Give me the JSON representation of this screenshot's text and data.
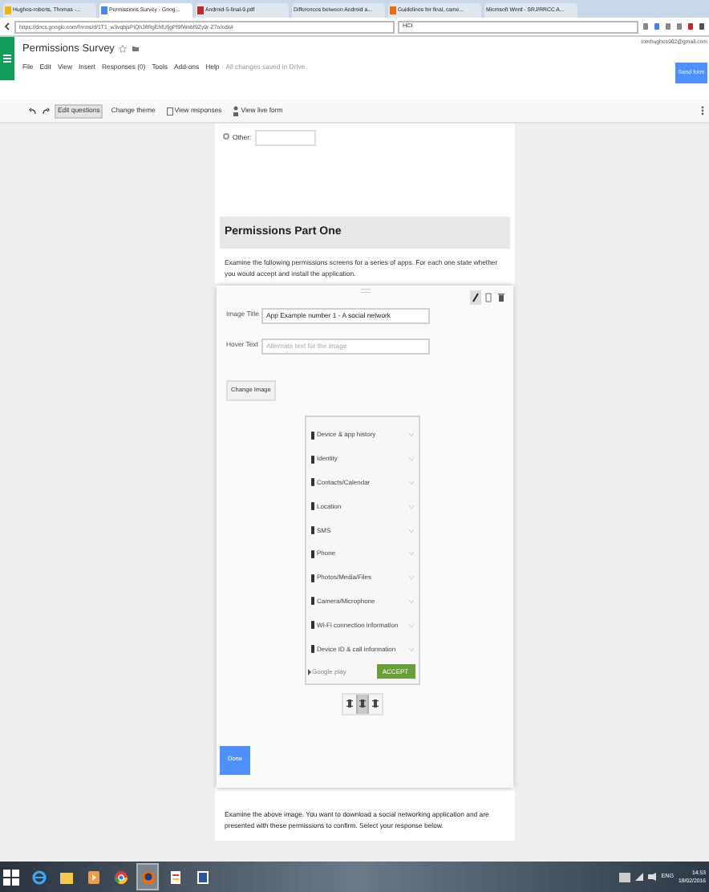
{
  "browser": {
    "tabs": [
      {
        "label": "Hughes-roberts, Thomas -...",
        "kind": "mail",
        "selected": false
      },
      {
        "label": "Permissions Survey - Goog...",
        "kind": "drive",
        "selected": true
      },
      {
        "label": "Android-5-final-9.pdf",
        "kind": "pdf",
        "selected": false
      },
      {
        "label": "Differences between Android a...",
        "kind": "blank",
        "selected": false
      },
      {
        "label": "Guidelines for final, came...",
        "kind": "doc",
        "selected": false
      },
      {
        "label": "Microsoft Word - SRJ/RRCC A...",
        "kind": "blank",
        "selected": false
      }
    ],
    "url": "https://docs.google.com/forms/d/1T1_w3vqbjsPiQhJ8RgEhfUfjgPf9fWnbf9Zy9r-Z7o/edit#",
    "search": {
      "value": "HCI"
    }
  },
  "app": {
    "title": "Permissions Survey",
    "account": "tomhughes902@gmail.com",
    "menu": [
      "File",
      "Edit",
      "View",
      "Insert",
      "Responses (0)",
      "Tools",
      "Add-ons",
      "Help"
    ],
    "save_status": "All changes saved in Drive",
    "send_button": "Send form"
  },
  "toolbar": {
    "buttons": [
      {
        "label": "Edit questions",
        "kind": "text",
        "selected": true
      },
      {
        "label": "Change theme",
        "kind": "text",
        "selected": false
      },
      {
        "label": "View responses",
        "kind": "sheet",
        "selected": false
      },
      {
        "label": "View live form",
        "kind": "person",
        "selected": false
      }
    ]
  },
  "form": {
    "other_option": {
      "label": "Other:",
      "selected": false
    },
    "section": {
      "title": "Permissions Part One",
      "description": "Examine the following permissions screens for a series of apps. For each one state whether you would accept and install the application."
    },
    "image_item": {
      "fields": [
        {
          "label": "Image Title",
          "value": "App Example number 1 - A social network"
        },
        {
          "label": "Hover Text",
          "placeholder": "Alternate text for the image"
        }
      ],
      "change_button": "Change Image",
      "image": {
        "permissions": [
          "Device & app history",
          "Identity",
          "Contacts/Calendar",
          "Location",
          "SMS",
          "Phone",
          "Photos/Media/Files",
          "Camera/Microphone",
          "Wi-Fi connection information",
          "Device ID & call information"
        ],
        "store_label": "Google play",
        "accept_button": "ACCEPT"
      },
      "alignment": [
        {
          "selected": false
        },
        {
          "selected": true
        },
        {
          "selected": false
        }
      ],
      "done_button": "Done"
    },
    "next_description": "Examine the above image. You want to download a social networking application and are presented with these permissions to confirm. Select your response below."
  },
  "taskbar": {
    "apps": [
      {
        "kind": "ie",
        "selected": false
      },
      {
        "kind": "folder",
        "selected": false
      },
      {
        "kind": "media",
        "selected": false
      },
      {
        "kind": "chrome",
        "selected": false
      },
      {
        "kind": "firefox",
        "selected": true
      },
      {
        "kind": "notes",
        "selected": false
      },
      {
        "kind": "word",
        "selected": false
      }
    ],
    "language": "ENG",
    "time": "14:53",
    "date": "18/02/2016"
  }
}
